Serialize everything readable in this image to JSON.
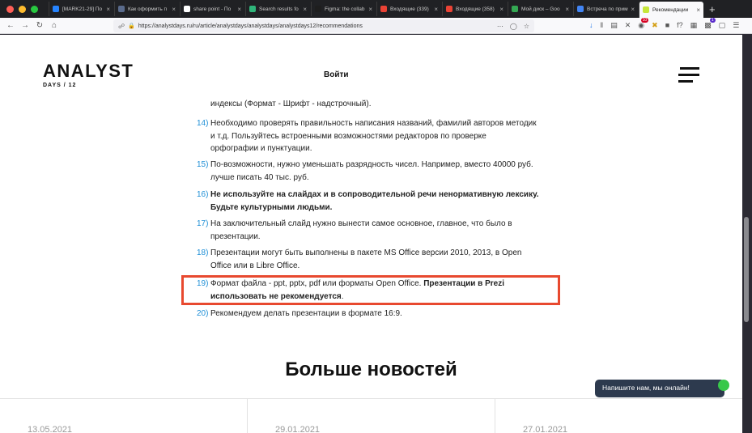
{
  "browser": {
    "tabs": [
      {
        "title": "[MARK21-29] По",
        "color": "#2684ff"
      },
      {
        "title": "Как оформить п",
        "color": "#5a6b8c"
      },
      {
        "title": "share point - По",
        "color": "#ffffff"
      },
      {
        "title": "Search results fo",
        "color": "#2fb57a"
      },
      {
        "title": "Figma: the collab",
        "color": "#1e1e1e"
      },
      {
        "title": "Входящие (339)",
        "color": "#ea4335"
      },
      {
        "title": "Входящие (358)",
        "color": "#ea4335"
      },
      {
        "title": "Мой диск – Goo",
        "color": "#34a853"
      },
      {
        "title": "Встреча по прим",
        "color": "#4285f4"
      },
      {
        "title": "Рекомендации",
        "color": "#c6e63a"
      }
    ],
    "active_tab_index": 9,
    "new_tab": "+",
    "url": "https://analystdays.ru/ru/article/analystdays/analystdays/analystdays12/recommendations",
    "notification_badges": [
      "10",
      "1"
    ]
  },
  "site": {
    "logo_main": "ANALYST",
    "logo_sub": "DAYS / 12",
    "login": "Войти"
  },
  "list_items": [
    {
      "num": "",
      "lines": [
        "индексы (Формат - Шрифт - надстрочный)."
      ]
    },
    {
      "num": "14)",
      "lines": [
        "Необходимо проверять правильность написания названий, фамилий авторов методик",
        "и т.д. Пользуйтесь встроенными возможностями редакторов по проверке",
        "орфографии и пунктуации."
      ]
    },
    {
      "num": "15)",
      "lines": [
        "По-возможности, нужно уменьшать разрядность чисел. Например, вместо 40000 руб.",
        "лучше писать 40 тыс. руб."
      ]
    },
    {
      "num": "16)",
      "lines": [
        "Не используйте на слайдах и в сопроводительной речи ненормативную лексику.",
        "Будьте культурными людьми."
      ]
    },
    {
      "num": "17)",
      "lines": [
        "На заключительный слайд нужно вынести самое основное, главное, что было в",
        "презентации."
      ]
    },
    {
      "num": "18)",
      "lines": [
        "Презентации могут быть выполнены в пакете MS Office версии 2010, 2013, в Open",
        "Office или в Libre Office."
      ]
    },
    {
      "num": "19)",
      "line1_plain": "Формат файла - ppt, pptx, pdf или форматы Open Office. ",
      "line1_bold": "Презентации в Prezi",
      "line2_bold": "использовать не рекомендуется",
      "line2_plain": "."
    },
    {
      "num": "20)",
      "lines": [
        "Рекомендуем делать презентации в формате 16:9."
      ]
    }
  ],
  "more_news": {
    "title": "Больше новостей",
    "dates": [
      "13.05.2021",
      "29.01.2021",
      "27.01.2021"
    ]
  },
  "chat_widget": {
    "label": "Напишите нам, мы онлайн!"
  }
}
